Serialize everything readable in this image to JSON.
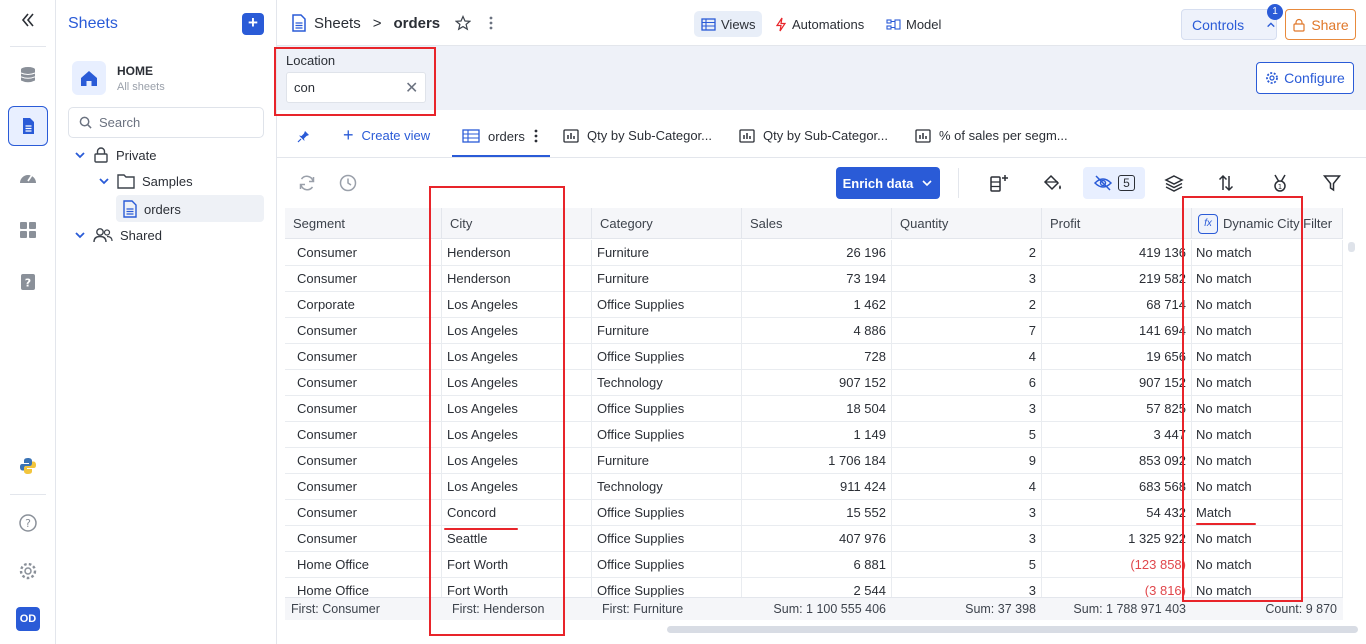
{
  "sidebar": {
    "title": "Sheets",
    "home_title": "HOME",
    "home_subtitle": "All sheets",
    "search_placeholder": "Search",
    "tree": {
      "private": "Private",
      "samples": "Samples",
      "orders": "orders",
      "shared": "Shared"
    }
  },
  "header": {
    "breadcrumb_root": "Sheets",
    "breadcrumb_sep": ">",
    "breadcrumb_current": "orders",
    "tabs": {
      "views": "Views",
      "automations": "Automations",
      "model": "Model"
    },
    "controls_label": "Controls",
    "controls_badge": "1",
    "share_label": "Share"
  },
  "filter": {
    "label": "Location",
    "value": "con",
    "configure_label": "Configure"
  },
  "view_tabs": {
    "create_view": "Create view",
    "orders": "orders",
    "qty1": "Qty by Sub-Categor...",
    "qty2": "Qty by Sub-Categor...",
    "pct": "% of sales per segm..."
  },
  "toolbar": {
    "enrich_label": "Enrich data",
    "hidden_count": "5"
  },
  "table": {
    "headers": {
      "segment": "Segment",
      "city": "City",
      "category": "Category",
      "sales": "Sales",
      "quantity": "Quantity",
      "profit": "Profit",
      "dynamic": "Dynamic City Filter"
    },
    "fx_label": "fx",
    "rows": [
      {
        "segment": "Consumer",
        "city": "Henderson",
        "category": "Furniture",
        "sales": "26 196",
        "quantity": "2",
        "profit": "419 136",
        "dynamic": "No match",
        "neg": false
      },
      {
        "segment": "Consumer",
        "city": "Henderson",
        "category": "Furniture",
        "sales": "73 194",
        "quantity": "3",
        "profit": "219 582",
        "dynamic": "No match",
        "neg": false
      },
      {
        "segment": "Corporate",
        "city": "Los Angeles",
        "category": "Office Supplies",
        "sales": "1 462",
        "quantity": "2",
        "profit": "68 714",
        "dynamic": "No match",
        "neg": false
      },
      {
        "segment": "Consumer",
        "city": "Los Angeles",
        "category": "Furniture",
        "sales": "4 886",
        "quantity": "7",
        "profit": "141 694",
        "dynamic": "No match",
        "neg": false
      },
      {
        "segment": "Consumer",
        "city": "Los Angeles",
        "category": "Office Supplies",
        "sales": "728",
        "quantity": "4",
        "profit": "19 656",
        "dynamic": "No match",
        "neg": false
      },
      {
        "segment": "Consumer",
        "city": "Los Angeles",
        "category": "Technology",
        "sales": "907 152",
        "quantity": "6",
        "profit": "907 152",
        "dynamic": "No match",
        "neg": false
      },
      {
        "segment": "Consumer",
        "city": "Los Angeles",
        "category": "Office Supplies",
        "sales": "18 504",
        "quantity": "3",
        "profit": "57 825",
        "dynamic": "No match",
        "neg": false
      },
      {
        "segment": "Consumer",
        "city": "Los Angeles",
        "category": "Office Supplies",
        "sales": "1 149",
        "quantity": "5",
        "profit": "3 447",
        "dynamic": "No match",
        "neg": false
      },
      {
        "segment": "Consumer",
        "city": "Los Angeles",
        "category": "Furniture",
        "sales": "1 706 184",
        "quantity": "9",
        "profit": "853 092",
        "dynamic": "No match",
        "neg": false
      },
      {
        "segment": "Consumer",
        "city": "Los Angeles",
        "category": "Technology",
        "sales": "911 424",
        "quantity": "4",
        "profit": "683 568",
        "dynamic": "No match",
        "neg": false
      },
      {
        "segment": "Consumer",
        "city": "Concord",
        "category": "Office Supplies",
        "sales": "15 552",
        "quantity": "3",
        "profit": "54 432",
        "dynamic": "Match",
        "neg": false
      },
      {
        "segment": "Consumer",
        "city": "Seattle",
        "category": "Office Supplies",
        "sales": "407 976",
        "quantity": "3",
        "profit": "1 325 922",
        "dynamic": "No match",
        "neg": false
      },
      {
        "segment": "Home Office",
        "city": "Fort Worth",
        "category": "Office Supplies",
        "sales": "6 881",
        "quantity": "5",
        "profit": "(123 858)",
        "dynamic": "No match",
        "neg": true
      },
      {
        "segment": "Home Office",
        "city": "Fort Worth",
        "category": "Office Supplies",
        "sales": "2 544",
        "quantity": "3",
        "profit": "(3 816)",
        "dynamic": "No match",
        "neg": true
      }
    ],
    "footer": {
      "segment": "First: Consumer",
      "city": "First: Henderson",
      "category": "First: Furniture",
      "sales": "Sum: 1 100 555 406",
      "quantity": "Sum: 37 398",
      "profit": "Sum: 1 788 971 403",
      "dynamic": "Count: 9 870"
    }
  },
  "icons": {
    "collapse": "double-chevron-left-icon",
    "database": "database-icon",
    "sheet": "sheet-icon",
    "dashboard": "gauge-icon",
    "apps": "grid-icon",
    "help_square": "question-square-icon",
    "python": "python-icon",
    "help": "help-circle-icon",
    "settings": "gear-icon"
  },
  "avatar": "OD",
  "colors": {
    "accent": "#2a5bd7",
    "share": "#e0782a",
    "negative": "#e0474c",
    "annotation": "#e8242a"
  }
}
